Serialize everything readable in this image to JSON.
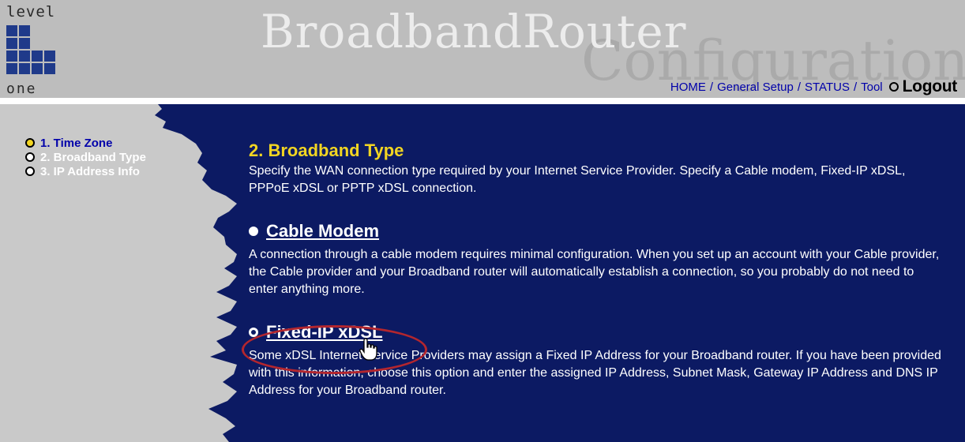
{
  "header": {
    "logo_top": "level",
    "logo_bottom": "one",
    "brand_title": "BroadbandRouter",
    "brand_subtitle": "Configuration",
    "nav": {
      "home": "HOME",
      "general_setup": "General Setup",
      "status": "STATUS",
      "tool": "Tool",
      "separator": "/",
      "logout": "Logout"
    }
  },
  "sidebar": {
    "items": [
      {
        "label": "1. Time Zone",
        "active": true
      },
      {
        "label": "2. Broadband Type",
        "active": false
      },
      {
        "label": "3. IP Address Info",
        "active": false
      }
    ]
  },
  "main": {
    "heading": "2. Broadband Type",
    "intro": "Specify the WAN connection type required by your Internet Service Provider. Specify a Cable modem, Fixed-IP xDSL, PPPoE xDSL or PPTP xDSL connection.",
    "options": [
      {
        "title": "Cable Modem",
        "selected": false,
        "description": "A connection through a cable modem requires minimal configuration. When you set up an account with your Cable provider, the Cable provider and your Broadband router will automatically establish a connection, so you probably do not need to enter anything more."
      },
      {
        "title": "Fixed-IP xDSL",
        "selected": true,
        "description": "Some xDSL Internet Service Providers may assign a Fixed IP Address for your Broadband router. If you have been provided with this information, choose this option and enter the assigned IP Address, Subnet Mask, Gateway IP Address and DNS IP Address for your Broadband router."
      }
    ]
  },
  "colors": {
    "header_bg": "#bdbdbd",
    "main_bg": "#0c1a63",
    "sidebar_bg": "#c9c9c9",
    "heading": "#f2d522",
    "highlight": "#b3262e",
    "link": "#0000aa"
  },
  "icons": {
    "cursor": "hand-pointer-icon",
    "bullet": "radio-circle-icon"
  }
}
